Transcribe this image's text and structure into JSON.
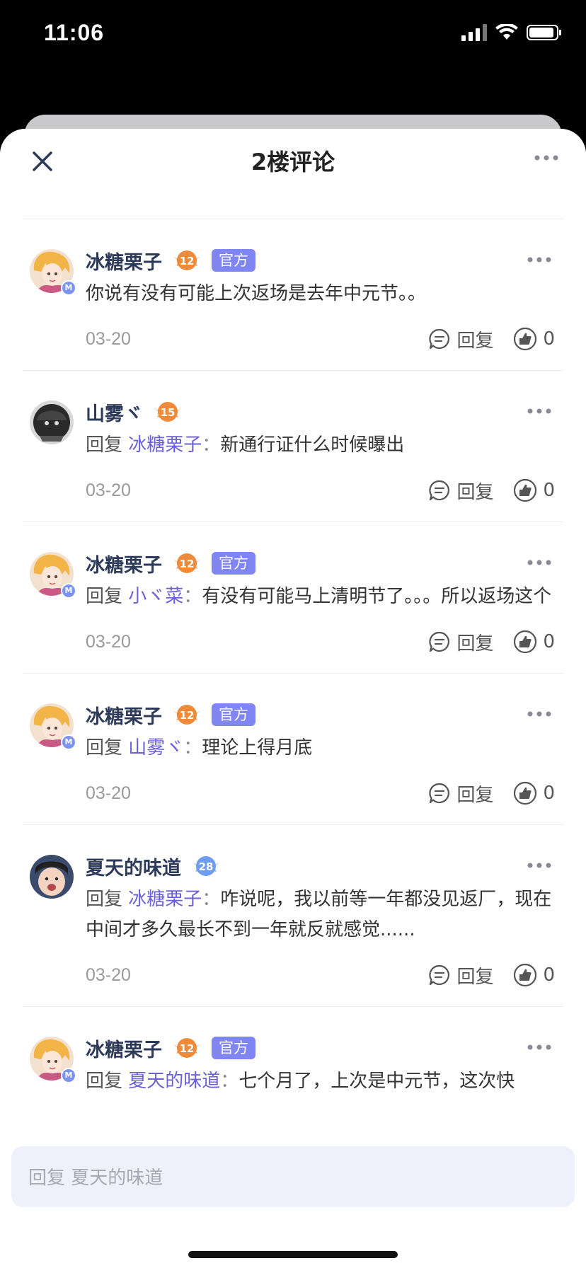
{
  "status": {
    "time": "11:06"
  },
  "header": {
    "title": "2楼评论"
  },
  "comments": [
    {
      "user": "冰糖栗子",
      "level": "12",
      "level_color": "#f08a3b",
      "official": "官方",
      "avatar": "anime",
      "badge": "M",
      "reply_label": "",
      "reply_to": "",
      "colon": "",
      "text": "你说有没有可能上次返场是去年中元节。。",
      "date": "03-20",
      "reply_btn": "回复",
      "likes": "0"
    },
    {
      "user": "山雾ヾ",
      "level": "15",
      "level_color": "#f08a3b",
      "official": "",
      "avatar": "dark",
      "badge": "",
      "reply_label": "回复",
      "reply_to": "冰糖栗子",
      "colon": "：",
      "text": "新通行证什么时候曝出",
      "date": "03-20",
      "reply_btn": "回复",
      "likes": "0"
    },
    {
      "user": "冰糖栗子",
      "level": "12",
      "level_color": "#f08a3b",
      "official": "官方",
      "avatar": "anime",
      "badge": "M",
      "reply_label": "回复",
      "reply_to": "小ヾ菜",
      "colon": "：",
      "text": "有没有可能马上清明节了。。。所以返场这个",
      "date": "03-20",
      "reply_btn": "回复",
      "likes": "0"
    },
    {
      "user": "冰糖栗子",
      "level": "12",
      "level_color": "#f08a3b",
      "official": "官方",
      "avatar": "anime",
      "badge": "M",
      "reply_label": "回复",
      "reply_to": "山雾ヾ",
      "colon": "：",
      "text": "理论上得月底",
      "date": "03-20",
      "reply_btn": "回复",
      "likes": "0"
    },
    {
      "user": "夏天的味道",
      "level": "28",
      "level_color": "#6d9cf0",
      "official": "",
      "avatar": "baby",
      "badge": "",
      "reply_label": "回复",
      "reply_to": "冰糖栗子",
      "colon": "：",
      "text": "咋说呢，我以前等一年都没见返厂，现在中间才多久最长不到一年就反就感觉......",
      "date": "03-20",
      "reply_btn": "回复",
      "likes": "0"
    },
    {
      "user": "冰糖栗子",
      "level": "12",
      "level_color": "#f08a3b",
      "official": "官方",
      "avatar": "anime",
      "badge": "M",
      "reply_label": "回复",
      "reply_to": "夏天的味道",
      "colon": "：",
      "text": "七个月了，上次是中元节，这次快",
      "date": "",
      "reply_btn": "",
      "likes": ""
    }
  ],
  "input": {
    "placeholder": "回复 夏天的味道"
  }
}
